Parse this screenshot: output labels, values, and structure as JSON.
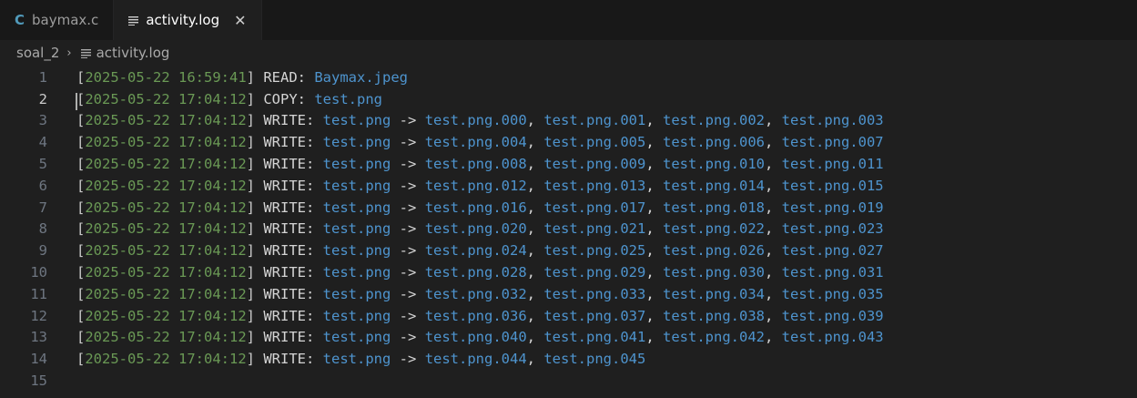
{
  "tabs": [
    {
      "icon": "c-file-icon",
      "icon_glyph": "C",
      "label": "baymax.c",
      "active": false
    },
    {
      "icon": "log-file-icon",
      "label": "activity.log",
      "active": true,
      "close": "✕"
    }
  ],
  "breadcrumb": {
    "folder": "soal_2",
    "separator": "›",
    "file": "activity.log"
  },
  "lines": [
    {
      "n": "1",
      "ts": "2025-05-22 16:59:41",
      "op": "READ:",
      "src": "Baymax.jpeg",
      "targets": []
    },
    {
      "n": "2",
      "ts": "2025-05-22 17:04:12",
      "op": "COPY:",
      "src": "test.png",
      "targets": []
    },
    {
      "n": "3",
      "ts": "2025-05-22 17:04:12",
      "op": "WRITE:",
      "src": "test.png",
      "targets": [
        "test.png.000",
        "test.png.001",
        "test.png.002",
        "test.png.003"
      ]
    },
    {
      "n": "4",
      "ts": "2025-05-22 17:04:12",
      "op": "WRITE:",
      "src": "test.png",
      "targets": [
        "test.png.004",
        "test.png.005",
        "test.png.006",
        "test.png.007"
      ]
    },
    {
      "n": "5",
      "ts": "2025-05-22 17:04:12",
      "op": "WRITE:",
      "src": "test.png",
      "targets": [
        "test.png.008",
        "test.png.009",
        "test.png.010",
        "test.png.011"
      ]
    },
    {
      "n": "6",
      "ts": "2025-05-22 17:04:12",
      "op": "WRITE:",
      "src": "test.png",
      "targets": [
        "test.png.012",
        "test.png.013",
        "test.png.014",
        "test.png.015"
      ]
    },
    {
      "n": "7",
      "ts": "2025-05-22 17:04:12",
      "op": "WRITE:",
      "src": "test.png",
      "targets": [
        "test.png.016",
        "test.png.017",
        "test.png.018",
        "test.png.019"
      ]
    },
    {
      "n": "8",
      "ts": "2025-05-22 17:04:12",
      "op": "WRITE:",
      "src": "test.png",
      "targets": [
        "test.png.020",
        "test.png.021",
        "test.png.022",
        "test.png.023"
      ]
    },
    {
      "n": "9",
      "ts": "2025-05-22 17:04:12",
      "op": "WRITE:",
      "src": "test.png",
      "targets": [
        "test.png.024",
        "test.png.025",
        "test.png.026",
        "test.png.027"
      ]
    },
    {
      "n": "10",
      "ts": "2025-05-22 17:04:12",
      "op": "WRITE:",
      "src": "test.png",
      "targets": [
        "test.png.028",
        "test.png.029",
        "test.png.030",
        "test.png.031"
      ]
    },
    {
      "n": "11",
      "ts": "2025-05-22 17:04:12",
      "op": "WRITE:",
      "src": "test.png",
      "targets": [
        "test.png.032",
        "test.png.033",
        "test.png.034",
        "test.png.035"
      ]
    },
    {
      "n": "12",
      "ts": "2025-05-22 17:04:12",
      "op": "WRITE:",
      "src": "test.png",
      "targets": [
        "test.png.036",
        "test.png.037",
        "test.png.038",
        "test.png.039"
      ]
    },
    {
      "n": "13",
      "ts": "2025-05-22 17:04:12",
      "op": "WRITE:",
      "src": "test.png",
      "targets": [
        "test.png.040",
        "test.png.041",
        "test.png.042",
        "test.png.043"
      ]
    },
    {
      "n": "14",
      "ts": "2025-05-22 17:04:12",
      "op": "WRITE:",
      "src": "test.png",
      "targets": [
        "test.png.044",
        "test.png.045"
      ]
    },
    {
      "n": "15",
      "ts": "",
      "op": "",
      "src": "",
      "targets": []
    }
  ],
  "arrow": "->",
  "cursor_line": "2",
  "colors": {
    "timestamp": "#6a9955",
    "filename": "#4e94ce",
    "text": "#d4d4d4",
    "background": "#1f1f1f"
  }
}
